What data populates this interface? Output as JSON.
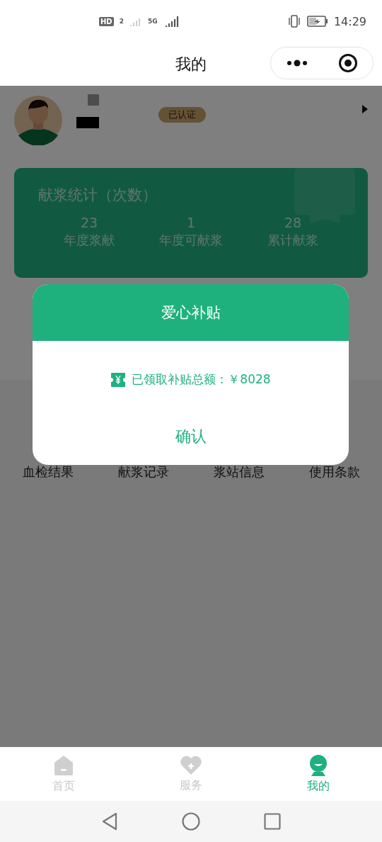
{
  "status_bar": {
    "hd": "HD",
    "sim": "2",
    "network": "5G",
    "time": "14:29"
  },
  "header": {
    "title": "我的"
  },
  "profile": {
    "badge": "已认证"
  },
  "stats": {
    "title": "献浆统计（次数）",
    "items": [
      {
        "value": "23",
        "label": "年度浆献"
      },
      {
        "value": "1",
        "label": "年度可献浆"
      },
      {
        "value": "28",
        "label": "累计献浆"
      }
    ]
  },
  "menu": [
    "血检结果",
    "献浆记录",
    "浆站信息",
    "使用条款"
  ],
  "dialog": {
    "title": "爱心补贴",
    "message": "已领取补贴总额：￥8028",
    "confirm": "确认"
  },
  "tabs": [
    {
      "kind": "home",
      "label": "首页",
      "selected": false
    },
    {
      "kind": "service",
      "label": "服务",
      "selected": false
    },
    {
      "kind": "mine",
      "label": "我的",
      "selected": true
    }
  ]
}
